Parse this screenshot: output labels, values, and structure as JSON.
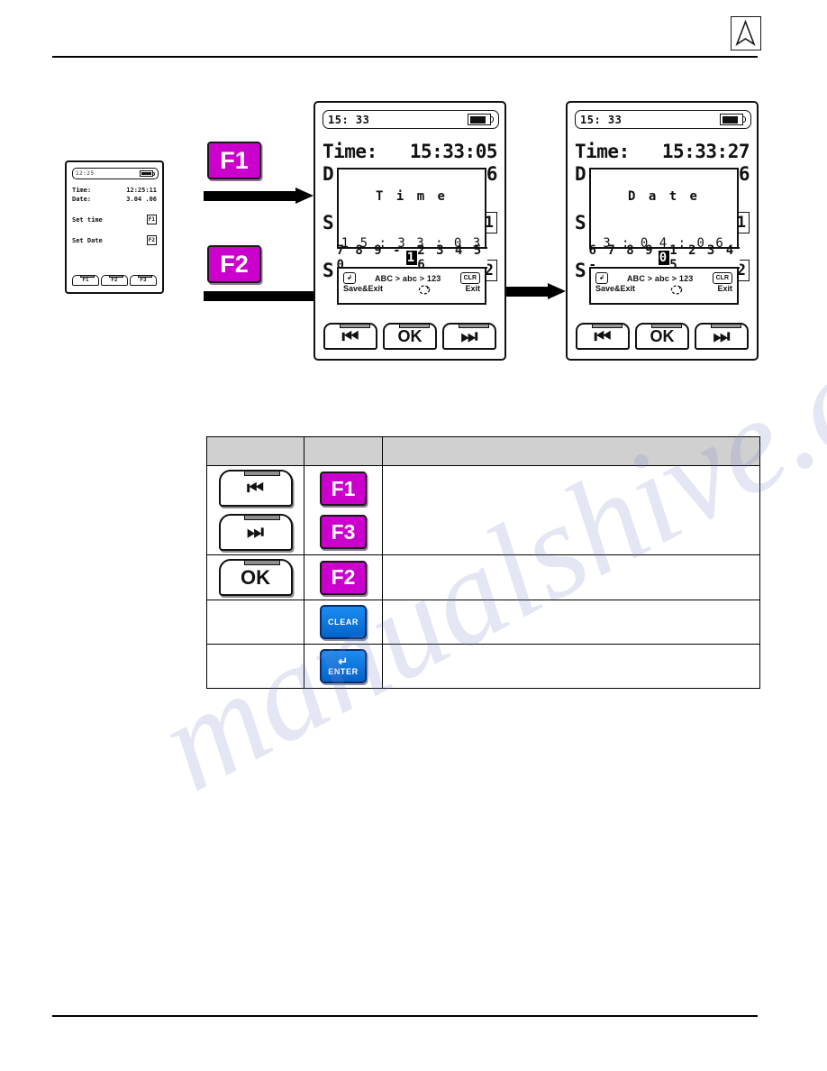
{
  "header": {
    "logo_name": "company-arrow-logo"
  },
  "watermark": {
    "text": "manualshive.com"
  },
  "flow": {
    "steps": [
      {
        "key_label": "F1",
        "name": "f1-flow-button"
      },
      {
        "key_label": "F2",
        "name": "f2-flow-button"
      }
    ]
  },
  "device_small": {
    "status_time": "12:25",
    "battery": "full",
    "rows": [
      {
        "label": "Time:",
        "value": "12:25:11"
      },
      {
        "label": "Date:",
        "value": "3.04 .06"
      }
    ],
    "menu": [
      {
        "label": "Set time",
        "key": "F1"
      },
      {
        "label": "Set Date",
        "key": "F2"
      }
    ],
    "softkeys": [
      "F1",
      "F2",
      "F3"
    ]
  },
  "device_time": {
    "status_time": "15: 33",
    "battery": "full",
    "rows": [
      {
        "label": "Time:",
        "value": "15:33:05"
      },
      {
        "label": "D",
        "value": "6"
      }
    ],
    "menu": [
      {
        "label": "S",
        "key": "1"
      },
      {
        "label": "S",
        "key": "2"
      }
    ],
    "dialog": {
      "title": "T i m e",
      "value": "1 5 : 3 3 : 0 3",
      "strip_before": "7 8 9 - 0",
      "strip_selected": "1",
      "strip_after": "2 3 4 5 6",
      "enter_cap": "↲",
      "save_exit_label": "Save&Exit",
      "mode_label": "ABC > abc > 123",
      "clr_cap": "CLR",
      "exit_label": "Exit"
    },
    "softkeys": [
      "⏮",
      "OK",
      "⏭"
    ]
  },
  "device_date": {
    "status_time": "15: 33",
    "battery": "full",
    "rows": [
      {
        "label": "Time:",
        "value": "15:33:27"
      },
      {
        "label": "D",
        "value": "6"
      }
    ],
    "menu": [
      {
        "label": "S",
        "key": "1"
      },
      {
        "label": "S",
        "key": "2"
      }
    ],
    "dialog": {
      "title": "D a t e",
      "value": "3 : 0 4 : 0 6",
      "strip_before": "6 7 8 9 -",
      "strip_selected": "0",
      "strip_after": "1 2 3 4 5",
      "enter_cap": "↲",
      "save_exit_label": "Save&Exit",
      "mode_label": "ABC > abc > 123",
      "clr_cap": "CLR",
      "exit_label": "Exit"
    },
    "softkeys": [
      "⏮",
      "OK",
      "⏭"
    ]
  },
  "legend": {
    "headers": [
      "",
      "",
      ""
    ],
    "rows": [
      {
        "softkeys": [
          "⏮",
          "⏭"
        ],
        "keys": [
          "F1",
          "F3"
        ],
        "key_type": "function",
        "description": ""
      },
      {
        "softkeys": [
          "OK"
        ],
        "keys": [
          "F2"
        ],
        "key_type": "function",
        "description": ""
      },
      {
        "softkeys": [],
        "keys": [
          "CLEAR"
        ],
        "key_type": "blue",
        "description": ""
      },
      {
        "softkeys": [],
        "keys": [
          "ENTER"
        ],
        "key_type": "blue-enter",
        "description": ""
      }
    ]
  },
  "colors": {
    "fkey_magenta": "#cc00cc",
    "bluekey": "#0a7de3",
    "table_header_gray": "#d0d0d0",
    "ink": "#000000"
  }
}
